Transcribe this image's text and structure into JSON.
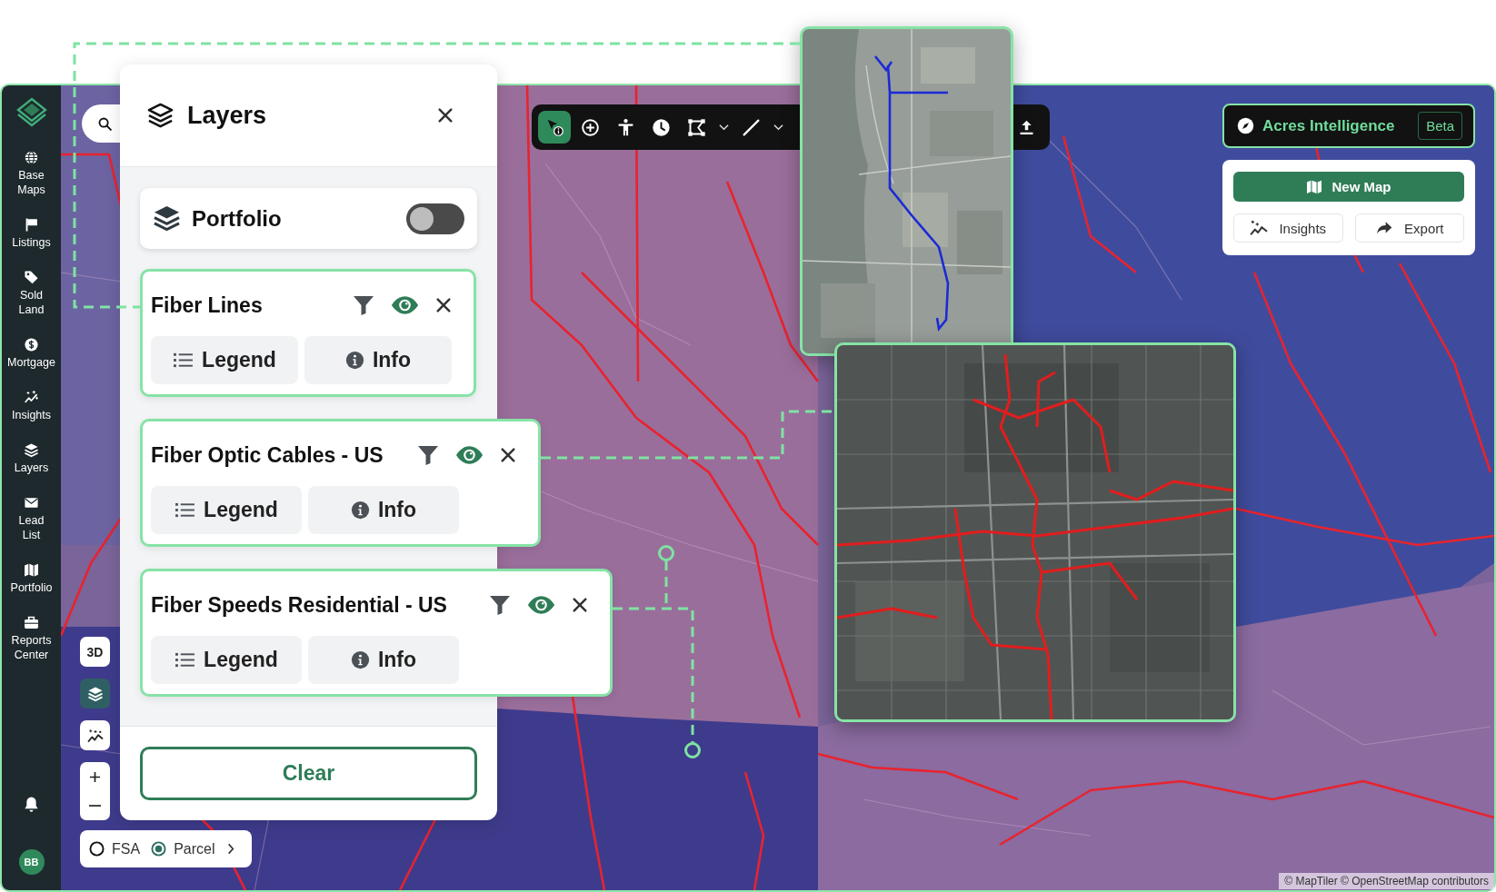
{
  "sidebar": {
    "items": [
      {
        "label": "Base Maps"
      },
      {
        "label": "Listings"
      },
      {
        "label": "Sold Land"
      },
      {
        "label": "Mortgage"
      },
      {
        "label": "Insights"
      },
      {
        "label": "Layers"
      },
      {
        "label": "Lead List"
      },
      {
        "label": "Portfolio"
      },
      {
        "label": "Reports Center"
      }
    ],
    "avatar": "BB"
  },
  "toolbar": {
    "tools": [
      {
        "kind": "identify",
        "selected": true
      },
      {
        "kind": "add",
        "selected": false
      },
      {
        "kind": "person",
        "selected": false
      },
      {
        "kind": "clock",
        "selected": false
      },
      {
        "kind": "polygon",
        "selected": false
      },
      {
        "kind": "menu",
        "selected": false
      },
      {
        "kind": "line",
        "selected": false
      },
      {
        "kind": "menu",
        "selected": false
      },
      {
        "kind": "upload",
        "selected": false
      }
    ]
  },
  "layers_panel": {
    "title": "Layers",
    "portfolio": {
      "label": "Portfolio",
      "on": false
    },
    "layers": [
      {
        "name": "Fiber Lines",
        "visible": true,
        "legend_button": "Legend",
        "info_button": "Info"
      },
      {
        "name": "Fiber Optic Cables - US",
        "visible": true,
        "legend_button": "Legend",
        "info_button": "Info"
      },
      {
        "name": "Fiber Speeds Residential - US",
        "visible": true,
        "legend_button": "Legend",
        "info_button": "Info"
      }
    ],
    "clear_button": "Clear"
  },
  "ai_panel": {
    "title": "Acres Intelligence",
    "badge": "Beta",
    "new_map_button": "New Map",
    "insights_button": "Insights",
    "export_button": "Export"
  },
  "map_controls": [
    {
      "kind": "label",
      "label": "3D",
      "selected": false
    },
    {
      "kind": "layers",
      "selected": true
    },
    {
      "kind": "insights",
      "selected": false
    }
  ],
  "boundary_toggle": [
    {
      "label": "FSA",
      "selected": false
    },
    {
      "label": "Parcel",
      "selected": true
    }
  ],
  "attribution": "© MapTiler © OpenStreetMap contributors"
}
